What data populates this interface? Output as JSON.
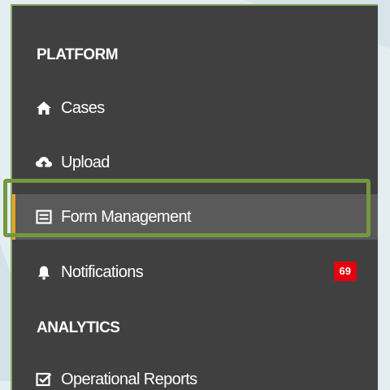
{
  "sections": {
    "platform": "PLATFORM",
    "analytics": "ANALYTICS"
  },
  "nav": {
    "cases": {
      "label": "Cases",
      "icon": "home-icon"
    },
    "upload": {
      "label": "Upload",
      "icon": "cloud-upload-icon"
    },
    "form_management": {
      "label": "Form Management",
      "icon": "form-icon",
      "active": true
    },
    "notifications": {
      "label": "Notifications",
      "icon": "bell-icon",
      "badge": "69"
    },
    "operational_reports": {
      "label": "Operational Reports",
      "icon": "checkbox-icon"
    }
  },
  "colors": {
    "sidebar_bg": "#404040",
    "active_bg": "#5a5a5a",
    "active_indicator": "#e6a323",
    "highlight_frame": "#75973f",
    "badge_bg": "#e3000f",
    "page_bg": "#e4eef2"
  }
}
